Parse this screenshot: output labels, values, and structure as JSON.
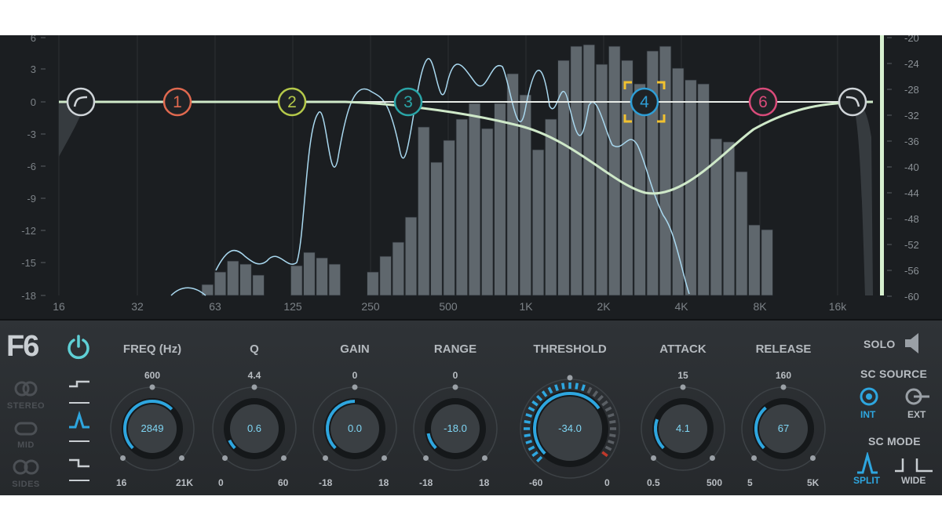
{
  "spectrum": {
    "y_left_labels": [
      "6",
      "3",
      "0",
      "-3",
      "-6",
      "-9",
      "-12",
      "-15",
      "-18"
    ],
    "y_right_labels": [
      "-20",
      "-24",
      "-28",
      "-32",
      "-36",
      "-40",
      "-44",
      "-48",
      "-52",
      "-56",
      "-60"
    ],
    "x_labels": [
      "16",
      "32",
      "63",
      "125",
      "250",
      "500",
      "1K",
      "2K",
      "4K",
      "8K",
      "16k"
    ]
  },
  "bands": [
    {
      "id": "lowcut",
      "label": "",
      "color": "#cfd4d8"
    },
    {
      "id": "band1",
      "label": "1",
      "color": "#e0694f"
    },
    {
      "id": "band2",
      "label": "2",
      "color": "#b5c94a"
    },
    {
      "id": "band3",
      "label": "3",
      "color": "#2aa5a7"
    },
    {
      "id": "band4",
      "label": "4",
      "color": "#2e9ed6",
      "selected": true
    },
    {
      "id": "band6",
      "label": "6",
      "color": "#d94b7a"
    },
    {
      "id": "highcut",
      "label": "",
      "color": "#cfd4d8"
    }
  ],
  "logo": "F6",
  "left_modes": {
    "stereo": "STEREO",
    "mid": "MID",
    "sides": "SIDES"
  },
  "params": [
    {
      "name": "FREQ (Hz)",
      "top": "600",
      "value": "2849",
      "min": "16",
      "max": "21K"
    },
    {
      "name": "Q",
      "top": "4.4",
      "value": "0.6",
      "min": "0",
      "max": "60"
    },
    {
      "name": "GAIN",
      "top": "0",
      "value": "0.0",
      "min": "-18",
      "max": "18"
    },
    {
      "name": "RANGE",
      "top": "0",
      "value": "-18.0",
      "min": "-18",
      "max": "18"
    },
    {
      "name": "THRESHOLD",
      "top": "",
      "value": "-34.0",
      "min": "-60",
      "max": "0"
    },
    {
      "name": "ATTACK",
      "top": "15",
      "value": "4.1",
      "min": "0.5",
      "max": "500"
    },
    {
      "name": "RELEASE",
      "top": "160",
      "value": "67",
      "min": "5",
      "max": "5K"
    }
  ],
  "right": {
    "solo": "SOLO",
    "sc_source": "SC SOURCE",
    "int": "INT",
    "ext": "EXT",
    "sc_mode": "SC MODE",
    "split": "SPLIT",
    "wide": "WIDE"
  },
  "colors": {
    "accent": "#2ea6df",
    "curve": "#cfe9c9",
    "selected": "#f2c230"
  }
}
